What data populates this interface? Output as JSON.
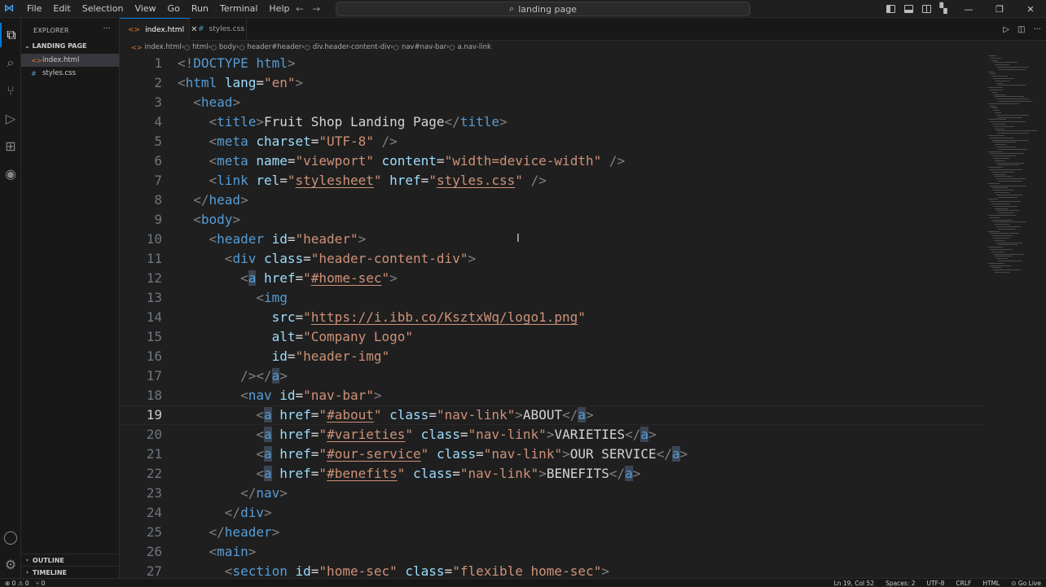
{
  "menu": [
    "File",
    "Edit",
    "Selection",
    "View",
    "Go",
    "Run",
    "Terminal",
    "Help"
  ],
  "search": {
    "text": "landing page"
  },
  "sidebar": {
    "title": "EXPLORER",
    "folder": "LANDING PAGE",
    "files": [
      {
        "name": "index.html",
        "icon": "<>"
      },
      {
        "name": "styles.css",
        "icon": "#"
      }
    ],
    "outline": "OUTLINE",
    "timeline": "TIMELINE"
  },
  "tabs": [
    {
      "name": "index.html",
      "icon": "<>"
    },
    {
      "name": "styles.css",
      "icon": "#"
    }
  ],
  "breadcrumb": [
    "index.html",
    "html",
    "body",
    "header#header",
    "div.header-content-div",
    "nav#nav-bar",
    "a.nav-link"
  ],
  "editor": {
    "current_line": 19,
    "lines": [
      "<!DOCTYPE html>",
      "<html lang=\"en\">",
      "  <head>",
      "    <title>Fruit Shop Landing Page</title>",
      "    <meta charset=\"UTF-8\" />",
      "    <meta name=\"viewport\" content=\"width=device-width\" />",
      "    <link rel=\"stylesheet\" href=\"styles.css\" />",
      "  </head>",
      "  <body>",
      "    <header id=\"header\">",
      "      <div class=\"header-content-div\">",
      "        <a href=\"#home-sec\">",
      "          <img",
      "            src=\"https://i.ibb.co/KsztxWq/logo1.png\"",
      "            alt=\"Company Logo\"",
      "            id=\"header-img\"",
      "        /></a>",
      "        <nav id=\"nav-bar\">",
      "          <a href=\"#about\" class=\"nav-link\">ABOUT</a>",
      "          <a href=\"#varieties\" class=\"nav-link\">VARIETIES</a>",
      "          <a href=\"#our-service\" class=\"nav-link\">OUR SERVICE</a>",
      "          <a href=\"#benefits\" class=\"nav-link\">BENEFITS</a>",
      "        </nav>",
      "      </div>",
      "    </header>",
      "    <main>",
      "      <section id=\"home-sec\" class=\"flexible home-sec\">"
    ]
  },
  "status": {
    "left": [
      "⊗ 0 ⚠ 0",
      "⑂ 0"
    ],
    "right": [
      "Ln 19, Col 52",
      "Spaces: 2",
      "UTF-8",
      "CRLF",
      "HTML",
      "⊙ Go Live"
    ]
  },
  "colors": {
    "tag": "#569cd6",
    "attr": "#9cdcfe",
    "string": "#ce9178",
    "text": "#d4d4d4",
    "punct": "#808080",
    "accent": "#0078d4"
  }
}
